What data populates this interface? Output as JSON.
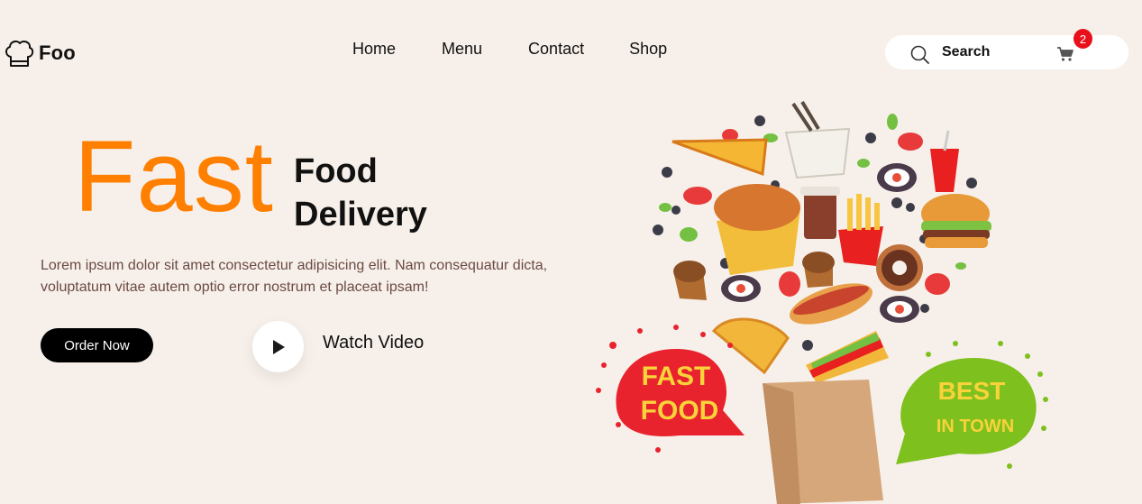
{
  "header": {
    "logo_text": "Foo",
    "nav": [
      "Home",
      "Menu",
      "Contact",
      "Shop"
    ],
    "search_label": "Search",
    "cart_count": "2"
  },
  "hero": {
    "title_big": "Fast",
    "title_line1": "Food",
    "title_line2": "Delivery",
    "description": "Lorem ipsum dolor sit amet consectetur adipisicing elit. Nam consequatur dicta, voluptatum vitae autem optio error nostrum et placeat ipsam!",
    "order_button": "Order Now",
    "watch_label": "Watch Video"
  },
  "illustration": {
    "badge_left_line1": "FAST",
    "badge_left_line2": "FOOD",
    "badge_right_line1": "BEST",
    "badge_right_line2": "IN TOWN"
  },
  "colors": {
    "background": "#f7f0ea",
    "accent": "#ff7f00",
    "badge": "#e8101a",
    "button": "#000000"
  },
  "icons": [
    "chef-hat-icon",
    "search-icon",
    "cart-icon",
    "play-icon"
  ]
}
